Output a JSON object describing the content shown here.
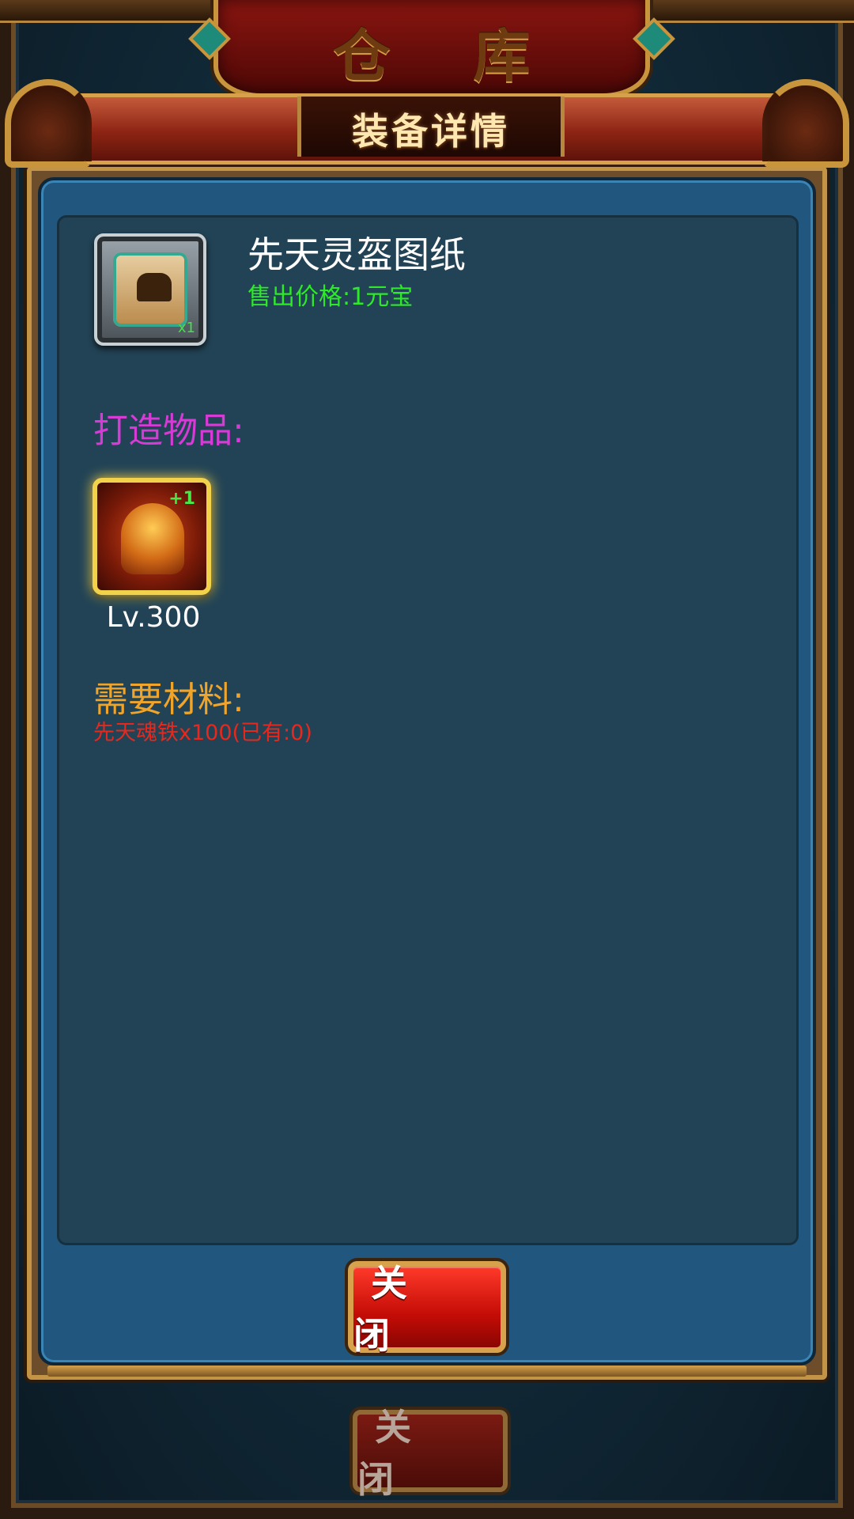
{
  "background": {
    "title": "仓 库",
    "close_button": "关 闭"
  },
  "dialog": {
    "title": "装备详情",
    "item": {
      "name": "先天灵盔图纸",
      "count": "x1",
      "sell_price": "售出价格:1元宝",
      "icon": "scroll-blueprint-icon"
    },
    "craft": {
      "label": "打造物品:",
      "product": {
        "plus": "+1",
        "level": "Lv.300",
        "icon": "helmet-icon"
      }
    },
    "materials": {
      "label": "需要材料:",
      "line": "先天魂铁x100(已有:0)"
    },
    "close_button": "关 闭"
  },
  "colors": {
    "price": "#2ee82a",
    "craft_label": "#d83ad6",
    "materials_label": "#f0a52a",
    "material_missing": "#e8281c",
    "panel": "#224356"
  }
}
